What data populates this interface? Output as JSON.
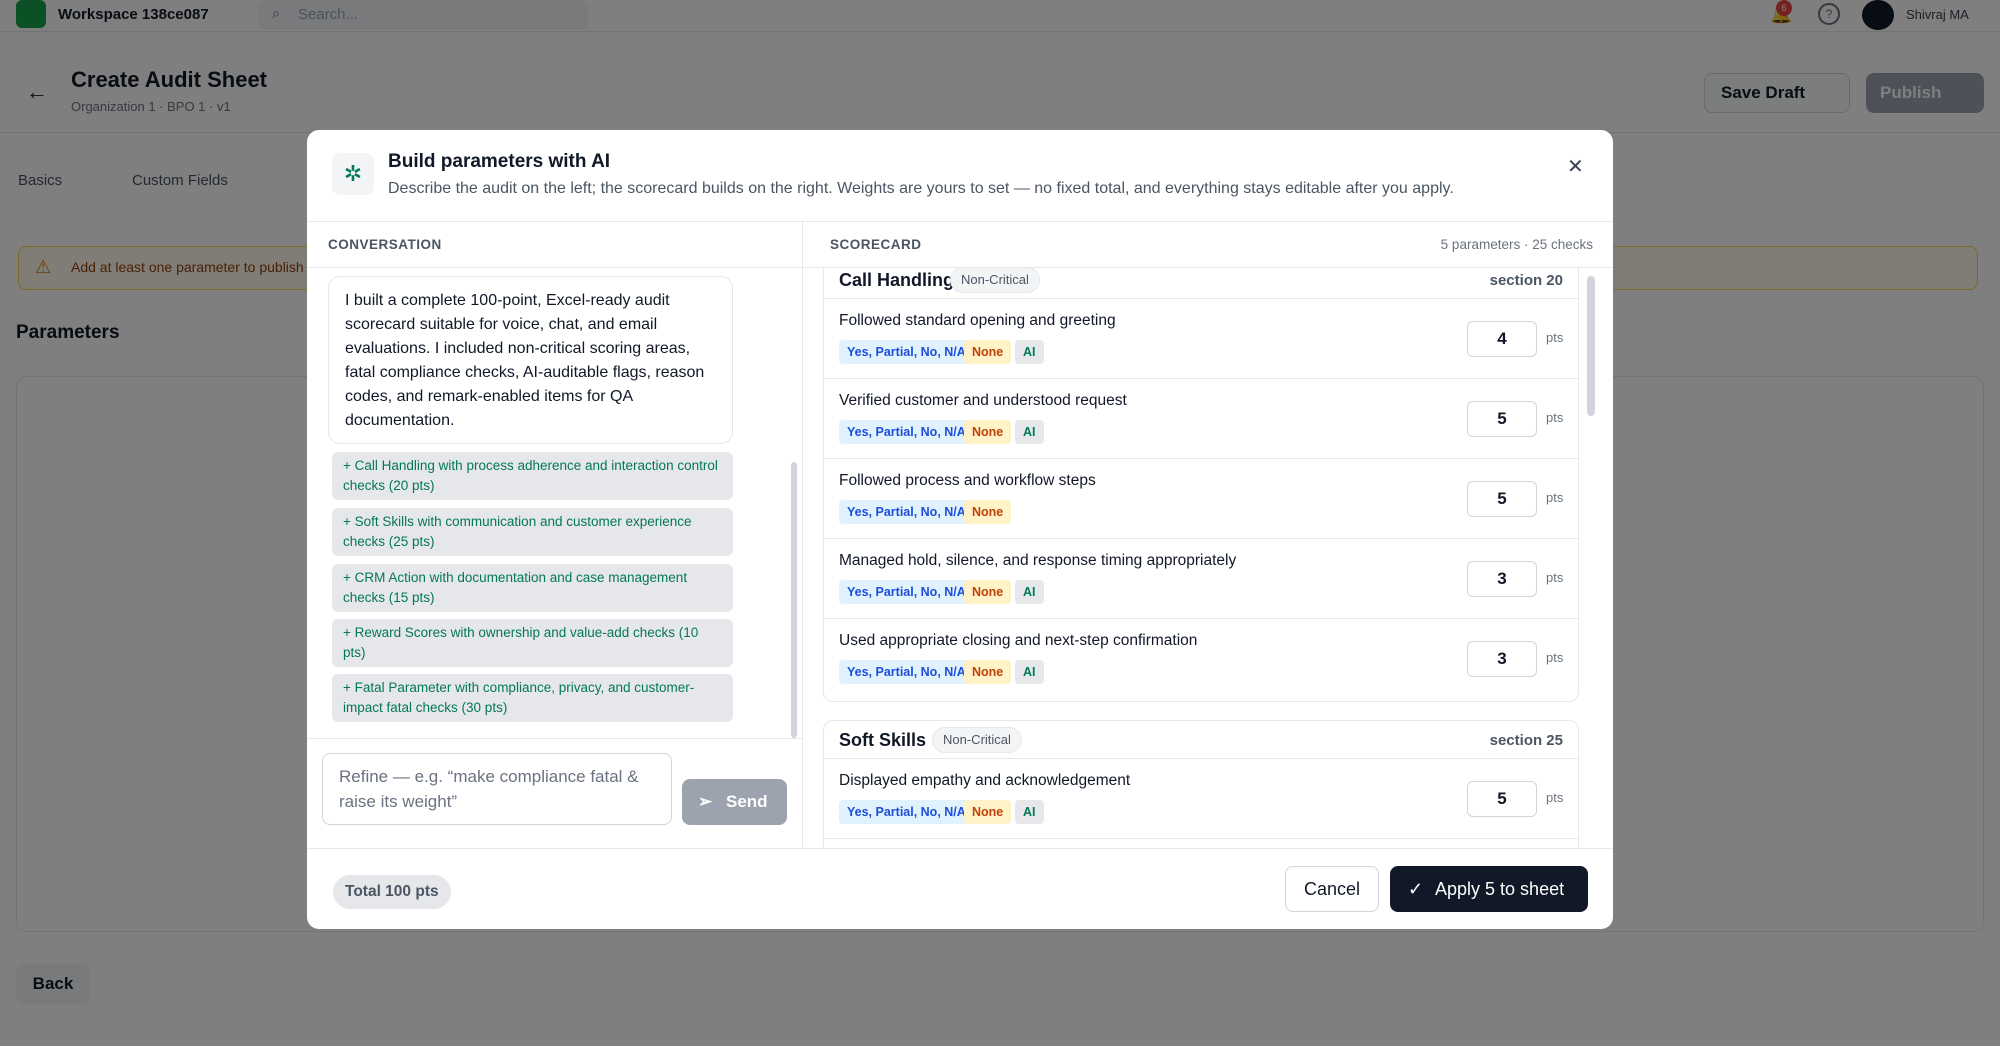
{
  "topbar": {
    "workspace_name": "Workspace 138ce087",
    "search_placeholder": "Search...",
    "notification_count": "6",
    "help_glyph": "?",
    "user_name": "Shivraj MA"
  },
  "page": {
    "title": "Create Audit Sheet",
    "subtitle": "Organization 1 · BPO 1 · v1",
    "save_draft_label": "Save Draft",
    "publish_label": "Publish",
    "tabs": [
      "Basics",
      "Custom Fields"
    ],
    "warning_text": "Add at least one parameter to publish",
    "parameters_title": "Parameters",
    "back_label": "Back"
  },
  "modal": {
    "title": "Build parameters with AI",
    "subtitle": "Describe the audit on the left; the scorecard builds on the right. Weights are yours to set — no fixed total, and everything stays editable after you apply.",
    "close_glyph": "✕",
    "icon": "sparkle-icon",
    "conversation": {
      "header": "CONVERSATION",
      "assistant_message": "I built a complete 100-point, Excel-ready audit scorecard suitable for voice, chat, and email evaluations. I included non-critical scoring areas, fatal compliance checks, AI-auditable flags, reason codes, and remark-enabled items for QA documentation.",
      "suggestions": [
        "+ Call Handling with process adherence and interaction control checks (20 pts)",
        "+ Soft Skills with communication and customer experience checks (25 pts)",
        "+ CRM Action with documentation and case management checks (15 pts)",
        "+ Reward Scores with ownership and value-add checks (10 pts)",
        "+ Fatal Parameter with compliance, privacy, and customer-impact fatal checks (30 pts)"
      ],
      "input_placeholder": "Refine — e.g. “make compliance fatal & raise its weight”",
      "send_label": "Send"
    },
    "scorecard": {
      "header": "SCORECARD",
      "meta": "5 parameters · 25 checks",
      "pts_unit": "pts",
      "sections": [
        {
          "name": "Call Handling",
          "badge": "Non-Critical",
          "total_label": "section 20",
          "checks": [
            {
              "label": "Followed standard opening and greeting",
              "options": "Yes, Partial, No, N/A",
              "fatal": "None",
              "ai": "AI",
              "points": "4"
            },
            {
              "label": "Verified customer and understood request",
              "options": "Yes, Partial, No, N/A",
              "fatal": "None",
              "ai": "AI",
              "points": "5"
            },
            {
              "label": "Followed process and workflow steps",
              "options": "Yes, Partial, No, N/A",
              "fatal": "None",
              "ai": "",
              "points": "5"
            },
            {
              "label": "Managed hold, silence, and response timing appropriately",
              "options": "Yes, Partial, No, N/A",
              "fatal": "None",
              "ai": "AI",
              "points": "3"
            },
            {
              "label": "Used appropriate closing and next-step confirmation",
              "options": "Yes, Partial, No, N/A",
              "fatal": "None",
              "ai": "AI",
              "points": "3"
            }
          ]
        },
        {
          "name": "Soft Skills",
          "badge": "Non-Critical",
          "total_label": "section 25",
          "checks": [
            {
              "label": "Displayed empathy and acknowledgement",
              "options": "Yes, Partial, No, N/A",
              "fatal": "None",
              "ai": "AI",
              "points": "5"
            }
          ]
        }
      ]
    },
    "footer": {
      "total_label": "Total 100 pts",
      "cancel_label": "Cancel",
      "apply_label": "Apply 5 to sheet"
    }
  }
}
